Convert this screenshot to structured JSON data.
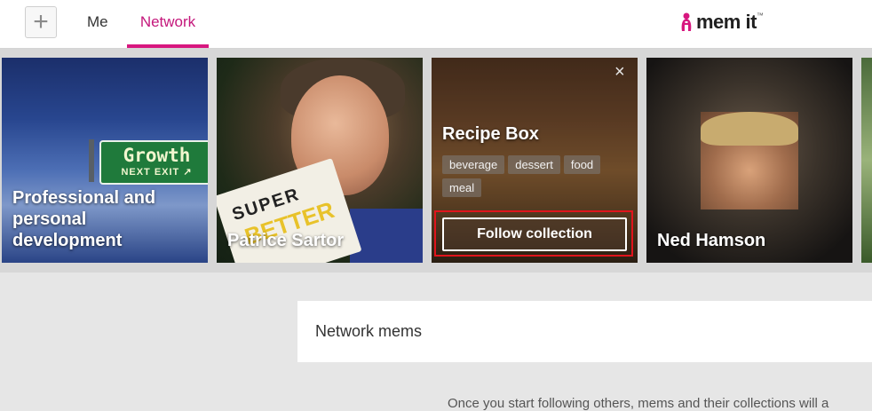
{
  "header": {
    "add_button_label": "+",
    "tabs": [
      {
        "label": "Me",
        "active": false
      },
      {
        "label": "Network",
        "active": true
      }
    ],
    "logo": "mem it",
    "logo_tm": "™",
    "accent_color": "#d7177f"
  },
  "cards": [
    {
      "title": "Professional and personal development",
      "sign_line1": "Growth",
      "sign_line2": "NEXT EXIT ↗"
    },
    {
      "title": "Patrice Sartor",
      "book_text1": "SUPER",
      "book_text2": "BETTER"
    },
    {
      "title": "Recipe Box",
      "close_icon": "×",
      "tags": [
        "beverage",
        "dessert",
        "food",
        "meal"
      ],
      "follow_label": "Follow collection"
    },
    {
      "title": "Ned Hamson"
    }
  ],
  "main": {
    "section_title": "Network mems",
    "footer_text_fragment": "Once you start following others, mems and their collections will a"
  }
}
